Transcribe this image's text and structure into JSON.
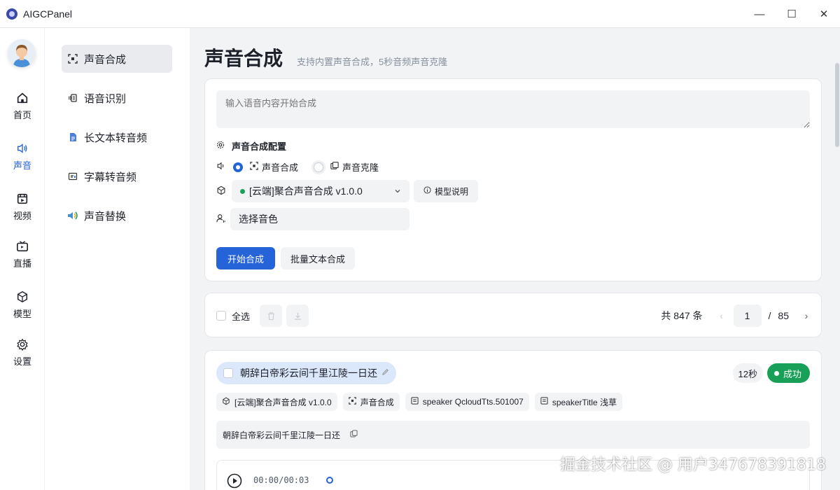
{
  "window": {
    "title": "AIGCPanel",
    "minimize": "—",
    "maximize": "☐",
    "close": "✕"
  },
  "iconbar": [
    {
      "label": "首页",
      "icon": "home-icon"
    },
    {
      "label": "声音",
      "icon": "speaker-icon",
      "active": true
    },
    {
      "label": "视频",
      "icon": "video-icon"
    },
    {
      "label": "直播",
      "icon": "tv-icon"
    },
    {
      "label": "模型",
      "icon": "cube-icon"
    },
    {
      "label": "设置",
      "icon": "gear-icon"
    }
  ],
  "submenu": [
    {
      "label": "声音合成",
      "icon": "scan-icon",
      "active": true
    },
    {
      "label": "语音识别",
      "icon": "mic-text-icon"
    },
    {
      "label": "长文本转音频",
      "icon": "document-icon"
    },
    {
      "label": "字幕转音频",
      "icon": "subtitle-icon"
    },
    {
      "label": "声音替换",
      "icon": "replace-icon"
    }
  ],
  "page": {
    "title": "声音合成",
    "subtitle": "支持内置声音合成，5秒音频声音克隆"
  },
  "form": {
    "placeholder": "输入语音内容开始合成",
    "config_title": "声音合成配置",
    "mode_synth": "声音合成",
    "mode_clone": "声音克隆",
    "model_select": "[云端]聚合声音合成 v1.0.0",
    "model_info": "模型说明",
    "voice_select": "选择音色",
    "start_button": "开始合成",
    "batch_button": "批量文本合成"
  },
  "listbar": {
    "select_all": "全选",
    "total": "共 847 条",
    "page": "1",
    "separator": "/",
    "pages": "85",
    "prev": "‹",
    "next": "›"
  },
  "record": {
    "title": "朝辞白帝彩云间千里江陵一日还",
    "duration": "12秒",
    "status": "成功",
    "tags": [
      "[云端]聚合声音合成 v1.0.0",
      "声音合成",
      "speaker QcloudTts.501007",
      "speakerTitle 浅草"
    ],
    "text": "朝辞白帝彩云间千里江陵一日还",
    "player_time": "00:00/00:03"
  },
  "watermark": "掘金技术社区 @ 用户347678391818",
  "colors": {
    "primary": "#2563d8",
    "success": "#18a058",
    "bg": "#f2f3f5"
  }
}
